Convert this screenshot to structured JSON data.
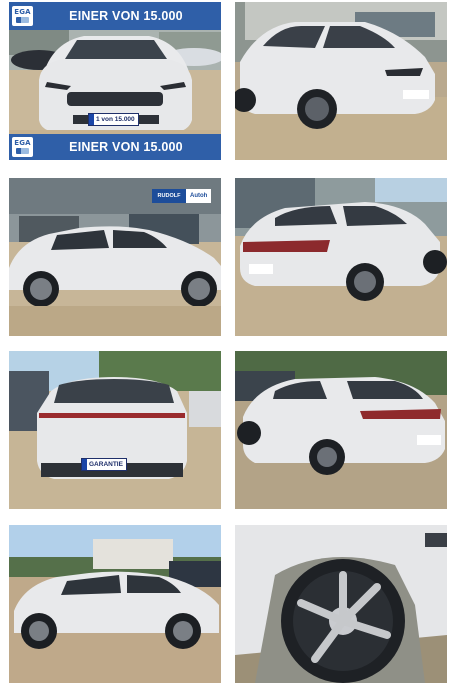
{
  "gallery": {
    "banner_text": "EINER VON 15.000",
    "dealer_logo_text": "EGA",
    "plate_front": "1 von 15.000",
    "plate_rear": "GARANTIE",
    "plate_side": "GARANTIE",
    "dealer_sign": "Autoh",
    "dealer_sign_badge": "RUDOLF",
    "colors": {
      "banner": "#2f5fa8",
      "car_body": "#e7e8ea"
    },
    "photos": [
      {
        "view": "front"
      },
      {
        "view": "front-right"
      },
      {
        "view": "left-side"
      },
      {
        "view": "rear-right"
      },
      {
        "view": "rear"
      },
      {
        "view": "rear-left"
      },
      {
        "view": "left-side-outdoor"
      },
      {
        "view": "front-wheel-closeup"
      }
    ]
  }
}
